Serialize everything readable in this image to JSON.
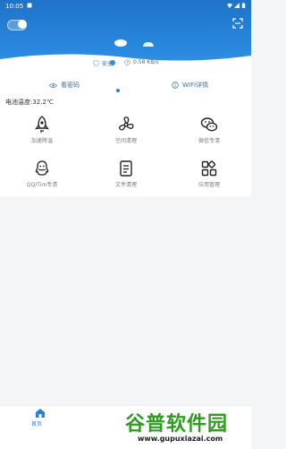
{
  "status_bar": {
    "time": "10:05"
  },
  "hero": {
    "safe_label": "安全",
    "speed_label": "0.58 KB/s",
    "actions": [
      {
        "label": "看密码"
      },
      {
        "label": "WIFI详情"
      }
    ]
  },
  "battery": {
    "text": "电池温度:32.2℃"
  },
  "grid": {
    "items": [
      {
        "label": "加速降温",
        "icon": "rocket-icon"
      },
      {
        "label": "空间清理",
        "icon": "fan-icon"
      },
      {
        "label": "微信专清",
        "icon": "wechat-icon"
      },
      {
        "label": "QQ/Tim专清",
        "icon": "qq-icon"
      },
      {
        "label": "文件清理",
        "icon": "file-icon"
      },
      {
        "label": "应用管理",
        "icon": "apps-icon"
      }
    ]
  },
  "bottom_nav": {
    "home_label": "首页"
  },
  "watermark": {
    "title": "谷普软件园",
    "url": "www.gupuxiazai.com"
  },
  "colors": {
    "primary": "#2a8ae0",
    "accent": "#2a7de1",
    "watermark_green": "#2e9c1f"
  }
}
